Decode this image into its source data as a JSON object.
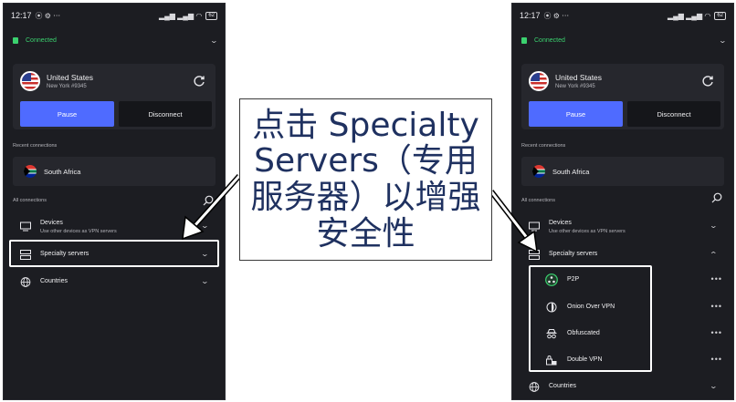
{
  "status_bar": {
    "time": "12:17",
    "left_icons": "⦿ ⚙ ⋯",
    "battery": "62"
  },
  "connected_label": "Connected",
  "current_server": {
    "country": "United States",
    "server": "New York #9345"
  },
  "buttons": {
    "pause": "Pause",
    "disconnect": "Disconnect"
  },
  "recent_label": "Recent connections",
  "recent_item": "South Africa",
  "all_label": "All connections",
  "devices": {
    "label": "Devices",
    "sub": "Use other devices as VPN servers"
  },
  "specialty": "Specialty servers",
  "countries": "Countries",
  "specialty_items": [
    {
      "label": "P2P",
      "icon": "p2p-icon"
    },
    {
      "label": "Onion Over VPN",
      "icon": "onion-icon"
    },
    {
      "label": "Obfuscated",
      "icon": "obfuscated-icon"
    },
    {
      "label": "Double VPN",
      "icon": "double-vpn-icon"
    }
  ],
  "more_glyph": "•••",
  "callout_text": "点击 Specialty Servers（专用服务器）以增强安全性",
  "colors": {
    "bg": "#1c1d22",
    "card": "#26272d",
    "accent": "#4f6bff",
    "connected": "#3bd16f",
    "callout_text": "#1f3160"
  }
}
